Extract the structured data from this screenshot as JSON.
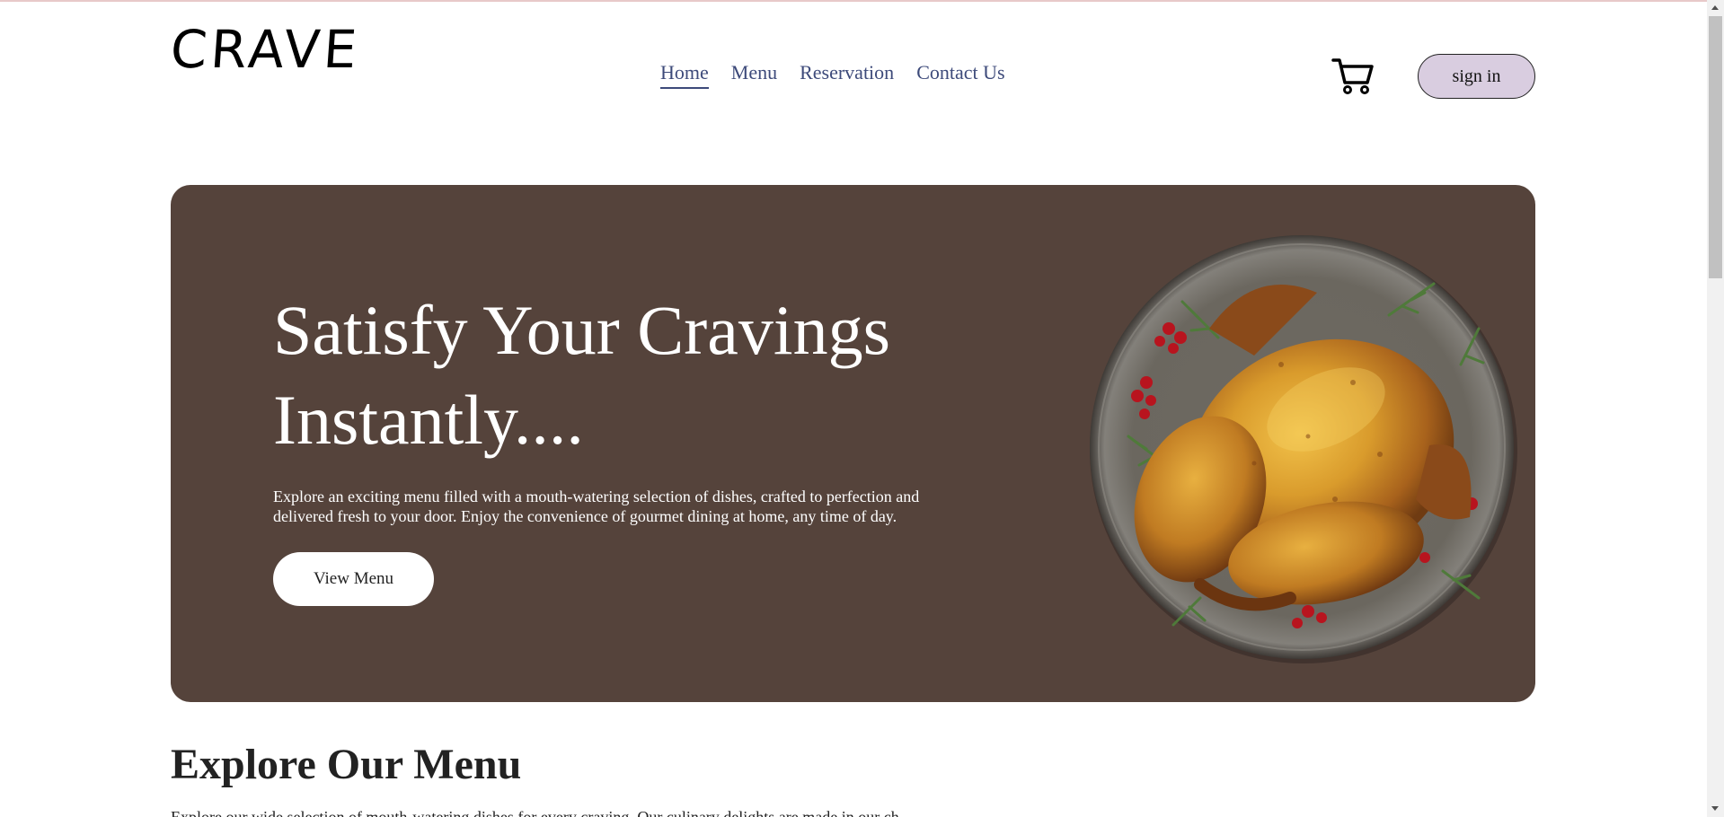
{
  "header": {
    "logo": "CRAVE",
    "nav": [
      {
        "label": "Home",
        "active": true
      },
      {
        "label": "Menu",
        "active": false
      },
      {
        "label": "Reservation",
        "active": false
      },
      {
        "label": "Contact Us",
        "active": false
      }
    ],
    "cart_icon": "shopping-cart-icon",
    "signin_label": "sign in"
  },
  "hero": {
    "title": "Satisfy Your Cravings Instantly....",
    "description": "Explore an exciting menu filled with a mouth-watering selection of dishes, crafted to perfection and delivered fresh to your door. Enjoy the convenience of gourmet dining at home, any time of day.",
    "button_label": "View Menu",
    "image": "roast-chicken-plate",
    "background_color": "#55433b"
  },
  "explore": {
    "title": "Explore Our Menu",
    "text": "Explore our wide selection of mouth-watering dishes for every craving. Our culinary delights are made in our ch"
  },
  "colors": {
    "nav_text": "#3d4a7a",
    "signin_bg": "#d9cde0",
    "hero_bg": "#55433b"
  }
}
